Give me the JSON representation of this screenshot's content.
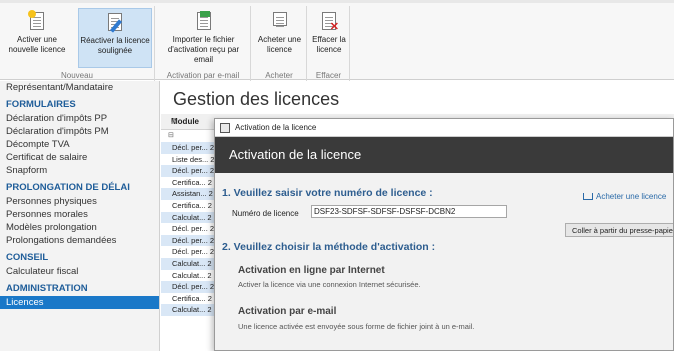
{
  "ribbon": {
    "groups": [
      {
        "label": "Nouveau"
      },
      {
        "label": "Activation par e-mail"
      },
      {
        "label": "Acheter"
      },
      {
        "label": "Effacer"
      }
    ],
    "buttons": {
      "activate": {
        "line1": "Activer une",
        "line2": "nouvelle licence",
        "icon": "new-license-icon"
      },
      "reactivate": {
        "line1": "Réactiver la licence",
        "line2": "soulignée",
        "icon": "reactivate-license-icon"
      },
      "import": {
        "line1": "Importer le fichier",
        "line2": "d'activation reçu par email",
        "icon": "import-file-icon"
      },
      "buy": {
        "line1": "Acheter une",
        "line2": "licence",
        "icon": "cart-icon"
      },
      "delete": {
        "line1": "Effacer la",
        "line2": "licence",
        "icon": "delete-license-icon"
      }
    }
  },
  "sidebar": {
    "items": [
      {
        "type": "item",
        "label": "Représentant/Mandataire"
      },
      {
        "type": "head",
        "label": "FORMULAIRES"
      },
      {
        "type": "item",
        "label": "Déclaration d'impôts PP"
      },
      {
        "type": "item",
        "label": "Déclaration d'impôts PM"
      },
      {
        "type": "item",
        "label": "Décompte TVA"
      },
      {
        "type": "item",
        "label": "Certificat de salaire"
      },
      {
        "type": "item",
        "label": "Snapform"
      },
      {
        "type": "head",
        "label": "PROLONGATION DE DÉLAI"
      },
      {
        "type": "item",
        "label": "Personnes physiques"
      },
      {
        "type": "item",
        "label": "Personnes morales"
      },
      {
        "type": "item",
        "label": "Modèles prolongation"
      },
      {
        "type": "item",
        "label": "Prolongations demandées"
      },
      {
        "type": "head",
        "label": "CONSEIL"
      },
      {
        "type": "item",
        "label": "Calculateur fiscal"
      },
      {
        "type": "head",
        "label": "ADMINISTRATION"
      },
      {
        "type": "item",
        "label": "Licences",
        "selected": true
      }
    ]
  },
  "main": {
    "title": "Gestion des licences",
    "table": {
      "headers": [
        "Module",
        "A"
      ],
      "filter": "⊟",
      "rows": [
        [
          "Décl. per...",
          "2"
        ],
        [
          "Liste des...",
          "2"
        ],
        [
          "Décl. per...",
          "2"
        ],
        [
          "Certifica...",
          "2"
        ],
        [
          "Assistan...",
          "2"
        ],
        [
          "Certifica...",
          "2"
        ],
        [
          "Calculat...",
          "2"
        ],
        [
          "Décl. per...",
          "2"
        ],
        [
          "Décl. per...",
          "2"
        ],
        [
          "Décl. per...",
          "2"
        ],
        [
          "Calculat...",
          "2"
        ],
        [
          "Calculat...",
          "2"
        ],
        [
          "Décl. per...",
          "2"
        ],
        [
          "Certifica...",
          "2"
        ],
        [
          "Calculat...",
          "2"
        ]
      ]
    }
  },
  "dialog": {
    "window_title": "Activation de la licence",
    "banner": "Activation de la licence",
    "step1": "1. Veuillez saisir votre numéro de licence :",
    "buy_link": "Acheter une licence",
    "license_label": "Numéro de licence",
    "license_value": "DSF23-SDFSF-SDFSF-DSFSF-DCBN2",
    "paste_button": "Coller à partir du presse-papiers",
    "step2": "2. Veuillez choisir la méthode d'activation :",
    "option_internet_title": "Activation en ligne par Internet",
    "option_internet_desc": "Activer la licence via une connexion Internet sécurisée.",
    "option_email_title": "Activation par e-mail",
    "option_email_desc": "Une licence activée est envoyée sous forme de fichier joint à un e-mail."
  },
  "colors": {
    "accent": "#1a78c8",
    "section_head": "#1f5d99",
    "dialog_banner": "#3a3a3a",
    "step_text": "#2d5d8f"
  }
}
